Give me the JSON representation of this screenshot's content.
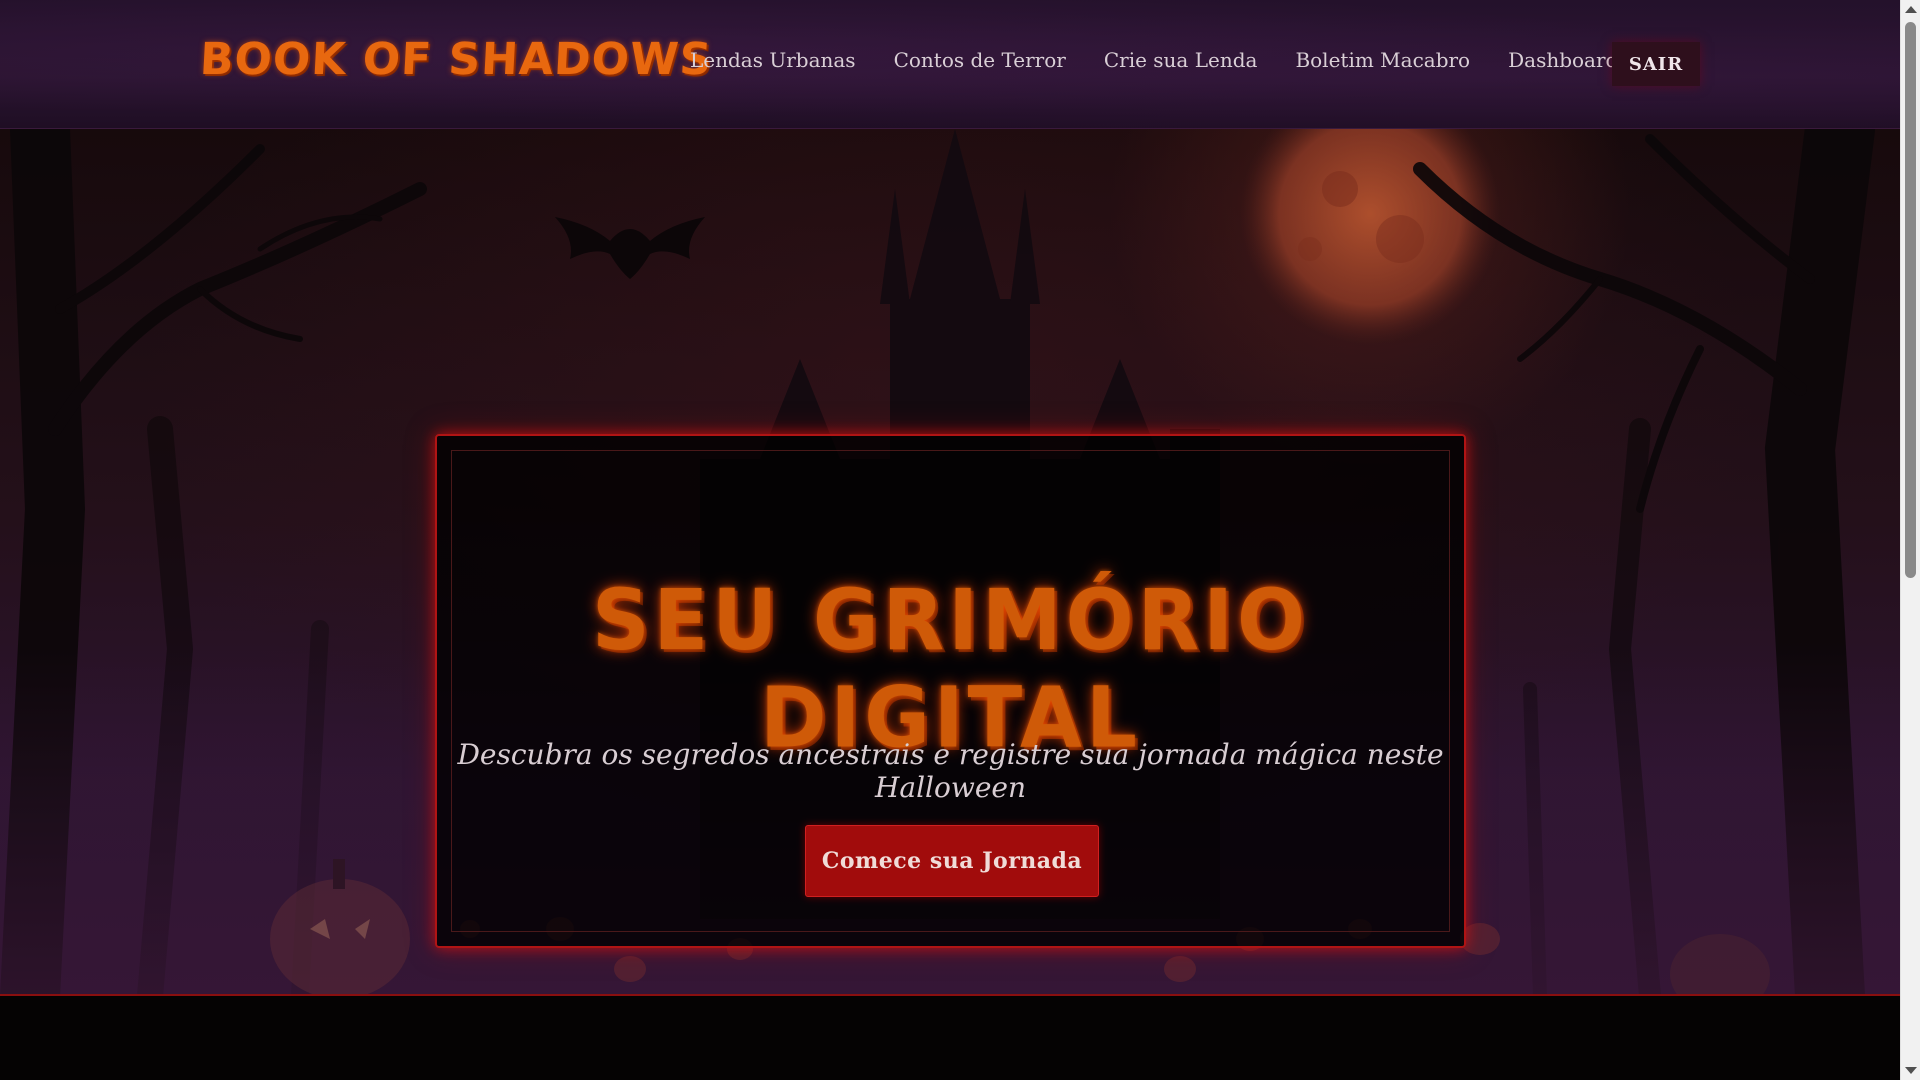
{
  "navbar": {
    "brand": "BOOK OF SHADOWS",
    "links": [
      {
        "label": "Lendas Urbanas"
      },
      {
        "label": "Contos de Terror"
      },
      {
        "label": "Crie sua Lenda"
      },
      {
        "label": "Boletim Macabro"
      },
      {
        "label": "Dashboard"
      }
    ],
    "logout_label": "SAIR"
  },
  "hero": {
    "title": "SEU GRIMÓRIO DIGITAL",
    "subtitle": "Descubra os segredos ancestrais e registre sua jornada mágica neste Halloween",
    "cta_label": "Comece sua Jornada"
  },
  "colors": {
    "brand_orange": "#e8680f",
    "title_orange": "#cf5a08",
    "cta_red": "#a10c0c",
    "card_border_red": "#b01414",
    "nav_background": "#24112b"
  },
  "icons": {
    "scroll_up": "triangle-up-icon",
    "scroll_down": "triangle-down-icon"
  }
}
